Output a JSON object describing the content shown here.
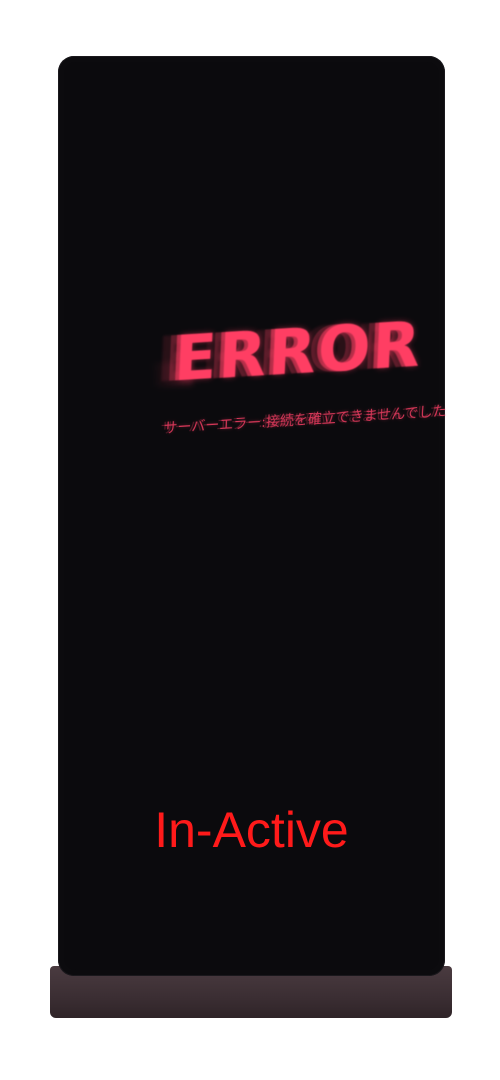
{
  "screen": {
    "error_title": "ERROR",
    "error_subtitle": "サーバーエラー:接続を確立できませんでした",
    "accent_color": "#ff3e63"
  },
  "status": {
    "label": "In-Active",
    "color": "#ff1a1a"
  },
  "device": {
    "type_icon": "kiosk-display-icon"
  }
}
